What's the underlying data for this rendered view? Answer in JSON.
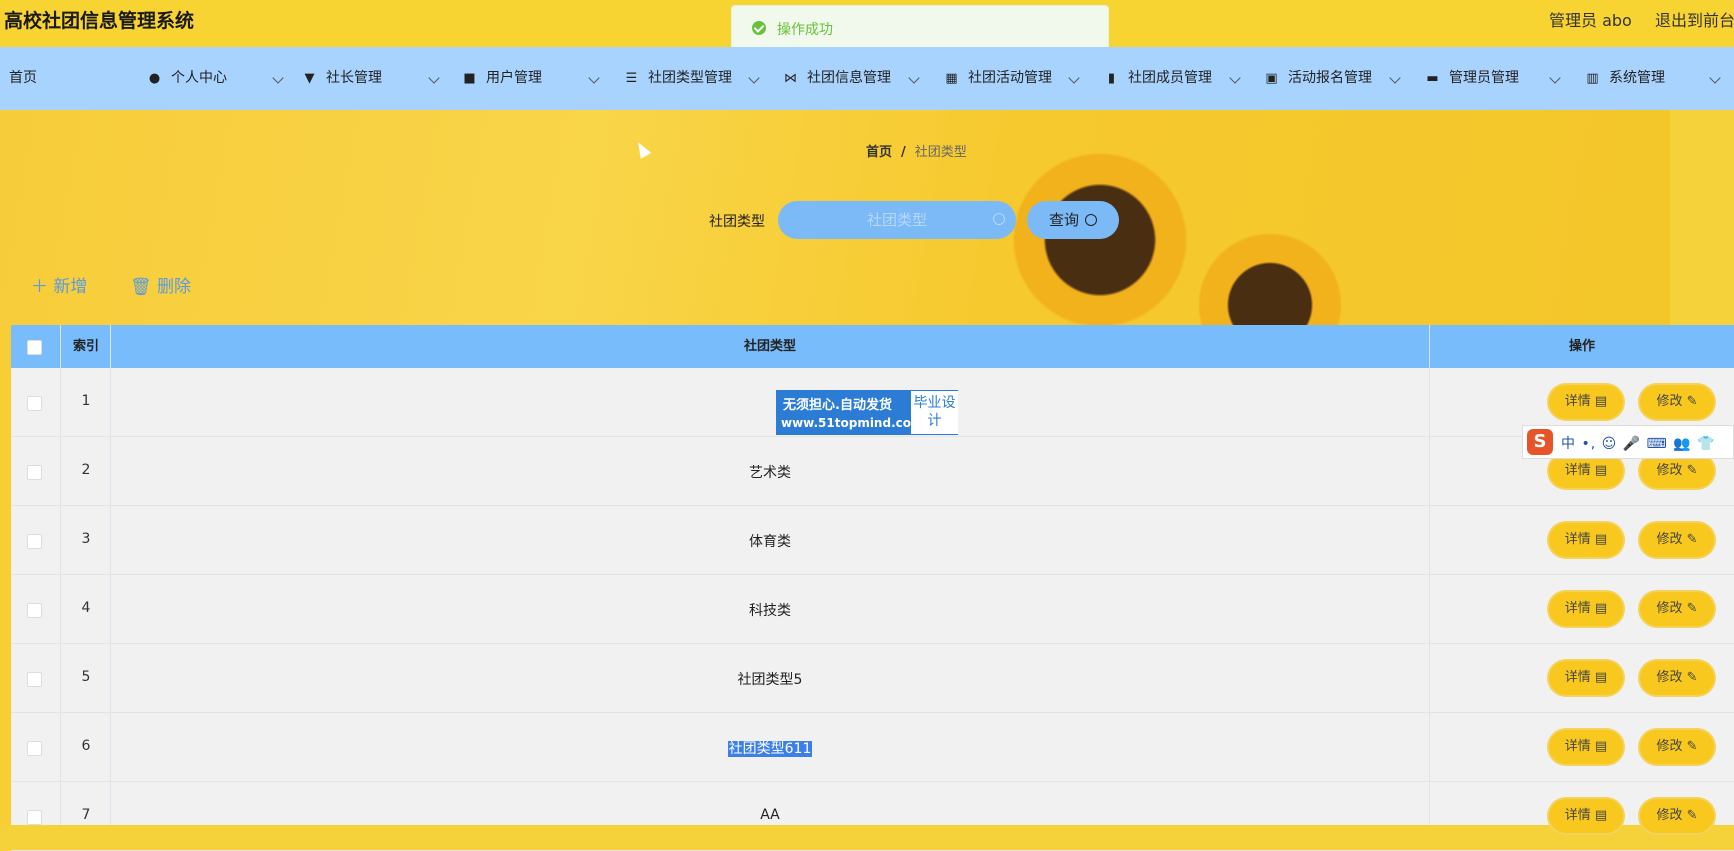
{
  "header": {
    "title": "高校社团信息管理系统",
    "admin": "管理员 abo",
    "logout": "退出到前台"
  },
  "toast": {
    "message": "操作成功"
  },
  "nav": [
    {
      "label": "首页",
      "icon": ""
    },
    {
      "label": "个人中心",
      "icon": "user-icon"
    },
    {
      "label": "社长管理",
      "icon": "president-icon"
    },
    {
      "label": "用户管理",
      "icon": "briefcase-icon"
    },
    {
      "label": "社团类型管理",
      "icon": "sliders-icon"
    },
    {
      "label": "社团信息管理",
      "icon": "bowtie-icon"
    },
    {
      "label": "社团活动管理",
      "icon": "grid-icon"
    },
    {
      "label": "社团成员管理",
      "icon": "clipboard-icon"
    },
    {
      "label": "活动报名管理",
      "icon": "chart-icon"
    },
    {
      "label": "管理员管理",
      "icon": "stamp-icon"
    },
    {
      "label": "系统管理",
      "icon": "bar-chart-icon"
    }
  ],
  "breadcrumb": {
    "home": "首页",
    "current": "社团类型"
  },
  "search": {
    "label": "社团类型",
    "placeholder": "社团类型",
    "button": "查询"
  },
  "actions": {
    "add": "新增",
    "delete": "删除"
  },
  "table": {
    "headers": {
      "index": "索引",
      "type": "社团类型",
      "ops": "操作"
    },
    "rows": [
      {
        "index": "1",
        "type": ""
      },
      {
        "index": "2",
        "type": "艺术类"
      },
      {
        "index": "3",
        "type": "体育类"
      },
      {
        "index": "4",
        "type": "科技类"
      },
      {
        "index": "5",
        "type": "社团类型5"
      },
      {
        "index": "6",
        "type": "社团类型611"
      },
      {
        "index": "7",
        "type": "AA"
      }
    ],
    "buttons": {
      "detail": "详情",
      "edit": "修改"
    }
  },
  "watermark": {
    "line1": "无须担心.自动发货",
    "line2": "www.51topmind.com",
    "right": "毕业设计"
  },
  "ime": {
    "logo": "S",
    "text": "中 •, ☺ 🎤 ⌨ 👥 👕"
  }
}
